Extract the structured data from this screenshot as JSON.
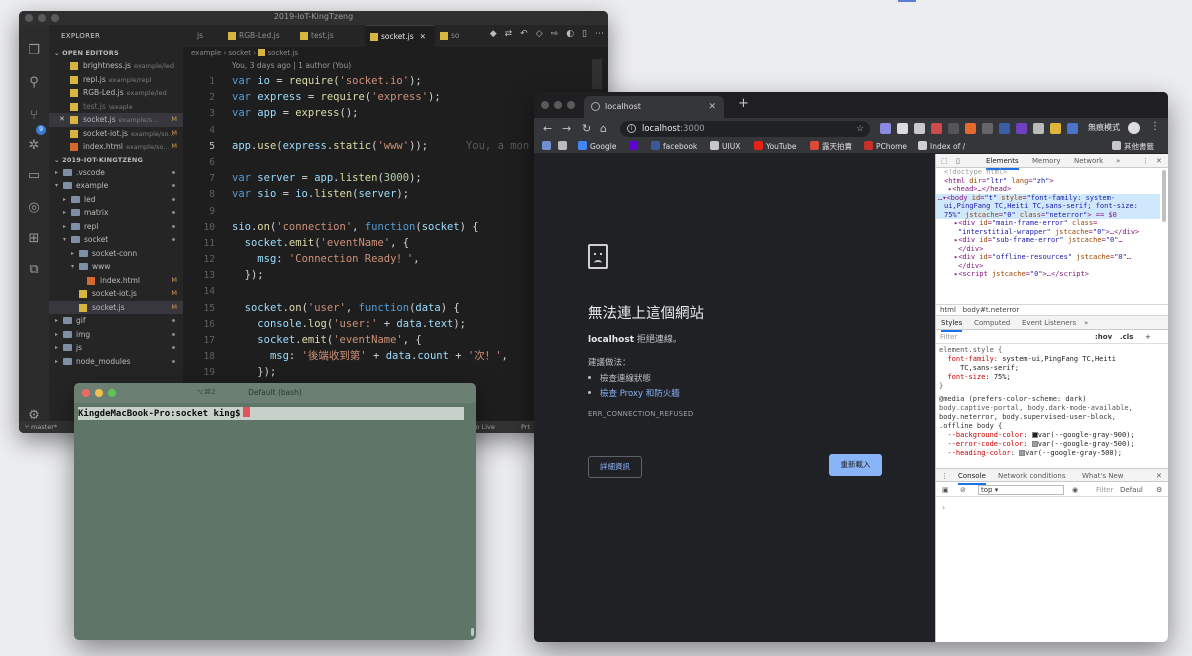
{
  "vscode": {
    "window_title": "2019-IoT-KingTzeng",
    "explorer_label": "EXPLORER",
    "open_editors_label": "OPEN EDITORS",
    "open_editors": [
      {
        "name": "brightness.js",
        "path": "example/led",
        "modified": "",
        "state": "normal"
      },
      {
        "name": "repl.js",
        "path": "example/repl",
        "modified": "",
        "state": "normal"
      },
      {
        "name": "RGB-Led.js",
        "path": "example/led",
        "modified": "",
        "state": "normal"
      },
      {
        "name": "test.js",
        "path": "\\exaple",
        "modified": "",
        "state": "dim"
      },
      {
        "name": "socket.js",
        "path": "example/s...",
        "modified": "M",
        "state": "selected"
      },
      {
        "name": "socket-iot.js",
        "path": "example/so...",
        "modified": "M",
        "state": "normal"
      },
      {
        "name": "index.html",
        "path": "example/so...",
        "modified": "M",
        "state": "normal"
      }
    ],
    "project_label": "2019-IOT-KINGTZENG",
    "tree": [
      {
        "name": ".vscode",
        "type": "folder",
        "indent": 0,
        "open": false,
        "modified": ""
      },
      {
        "name": "example",
        "type": "folder",
        "indent": 0,
        "open": true,
        "modified": ""
      },
      {
        "name": "led",
        "type": "folder",
        "indent": 1,
        "open": false,
        "modified": ""
      },
      {
        "name": "matrix",
        "type": "folder",
        "indent": 1,
        "open": false,
        "modified": ""
      },
      {
        "name": "repl",
        "type": "folder",
        "indent": 1,
        "open": false,
        "modified": ""
      },
      {
        "name": "socket",
        "type": "folder",
        "indent": 1,
        "open": true,
        "modified": ""
      },
      {
        "name": "socket-conn",
        "type": "folder",
        "indent": 2,
        "open": false,
        "modified": ""
      },
      {
        "name": "www",
        "type": "folder",
        "indent": 2,
        "open": true,
        "modified": ""
      },
      {
        "name": "index.html",
        "type": "html",
        "indent": 3,
        "open": false,
        "modified": "M"
      },
      {
        "name": "socket-iot.js",
        "type": "js",
        "indent": 2,
        "open": false,
        "modified": "M"
      },
      {
        "name": "socket.js",
        "type": "js",
        "indent": 2,
        "open": false,
        "modified": "M"
      },
      {
        "name": "gif",
        "type": "folder",
        "indent": 0,
        "open": false,
        "modified": ""
      },
      {
        "name": "img",
        "type": "folder",
        "indent": 0,
        "open": false,
        "modified": ""
      },
      {
        "name": "js",
        "type": "folder",
        "indent": 0,
        "open": false,
        "modified": ""
      },
      {
        "name": "node_modules",
        "type": "folder",
        "indent": 0,
        "open": false,
        "modified": ""
      }
    ],
    "tabs": [
      {
        "label": "js",
        "active": false
      },
      {
        "label": "RGB-Led.js",
        "active": false
      },
      {
        "label": "test.js",
        "active": false
      },
      {
        "label": "socket.js",
        "active": true
      },
      {
        "label": "so",
        "active": false
      }
    ],
    "breadcrumb": {
      "a": "example",
      "b": "socket",
      "c": "socket.js"
    },
    "blame": "You, 3 days ago | 1 author (You)",
    "ghost_text": "You, a mon",
    "line_numbers": [
      "1",
      "2",
      "3",
      "4",
      "5",
      "6",
      "7",
      "8",
      "9",
      "10",
      "11",
      "12",
      "13",
      "14",
      "15",
      "16",
      "17",
      "18",
      "19"
    ],
    "status_left": "master*",
    "status_golive": "Go Live",
    "status_right": "Prt"
  },
  "terminal": {
    "title": "Default (bash)",
    "shortcut": "⌥⌘2",
    "prompt": "KingdeMacBook-Pro:socket king$"
  },
  "chrome": {
    "tab_title": "localhost",
    "url_host": "localhost",
    "url_port": ":3000",
    "incognito_label": "無痕模式",
    "bookmarks": [
      {
        "label": "Google",
        "color": "#4285f4"
      },
      {
        "label": "facebook",
        "color": "#3b5998"
      },
      {
        "label": "UIUX",
        "color": "#c7c7c7"
      },
      {
        "label": "YouTube",
        "color": "#e62117"
      },
      {
        "label": "露天拍賣",
        "color": "#d94a38"
      },
      {
        "label": "PChome",
        "color": "#c9302c"
      },
      {
        "label": "Index of /",
        "color": "#cfcfcf"
      },
      {
        "label": "其他書籤",
        "color": "#c7c7c7"
      }
    ],
    "error": {
      "title": "無法連上這個網站",
      "host": "localhost",
      "refused": "拒絕連線。",
      "try_label": "建議做法：",
      "suggestions": [
        "檢查連線狀態",
        "檢查 Proxy 和防火牆"
      ],
      "code": "ERR_CONNECTION_REFUSED",
      "details_button": "詳細資訊",
      "reload_button": "重新載入"
    },
    "devtools": {
      "tabs": [
        "Elements",
        "Memory",
        "Network"
      ],
      "breadcrumb_html": "html",
      "breadcrumb_body": "body#t.neterror",
      "style_tabs": [
        "Styles",
        "Computed",
        "Event Listeners"
      ],
      "filter_placeholder": "Filter",
      "hov": ":hov",
      "cls": ".cls",
      "console_tabs": [
        "Console",
        "Network conditions",
        "What's New"
      ],
      "context": "top",
      "console_filter": "Filter",
      "levels": "Defaul"
    }
  }
}
